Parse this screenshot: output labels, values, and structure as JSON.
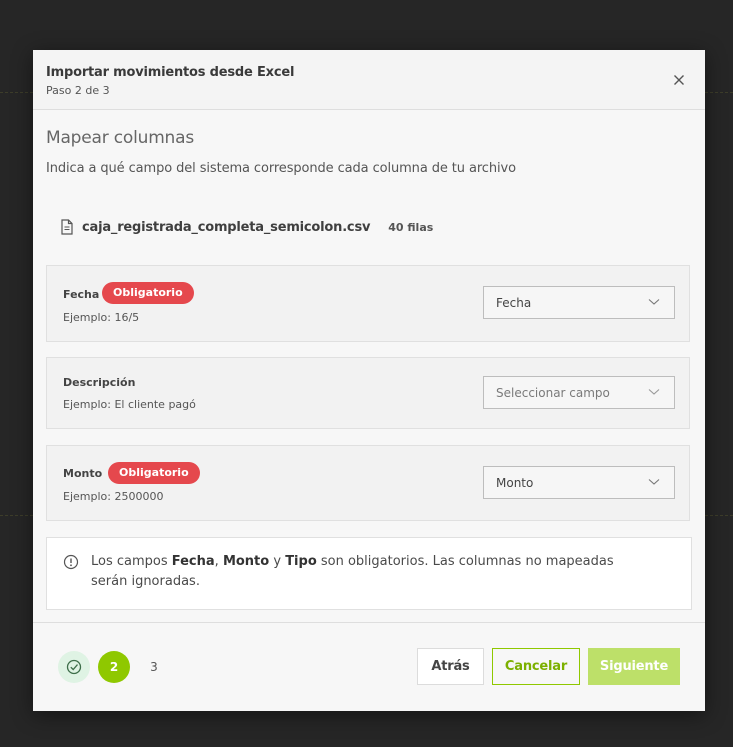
{
  "modal": {
    "title": "Importar movimientos desde Excel",
    "subtitle": "Paso 2 de 3"
  },
  "section": {
    "title": "Mapear columnas",
    "description": "Indica a qué campo del sistema corresponde cada columna de tu archivo"
  },
  "file": {
    "icon": "file-icon",
    "name": "caja_registrada_completa_semicolon.csv",
    "rows": "40 filas"
  },
  "mappings": [
    {
      "field": "Fecha",
      "required_label": "Obligatorio",
      "example": "Ejemplo: 16/5",
      "selected": "Fecha"
    },
    {
      "field": "Descripción",
      "example": "Ejemplo: El cliente pagó",
      "placeholder": "Seleccionar campo"
    },
    {
      "field": "Monto",
      "required_label": "Obligatorio",
      "example": "Ejemplo: 2500000",
      "selected": "Monto"
    }
  ],
  "info": {
    "prefix": "Los campos ",
    "f1": "Fecha",
    "sep1": ", ",
    "f2": "Monto",
    "sep2": " y ",
    "f3": "Tipo",
    "suffix": " son obligatorios. Las columnas no mapeadas serán ignoradas."
  },
  "stepper": {
    "current": "2",
    "next": "3"
  },
  "buttons": {
    "back": "Atrás",
    "cancel": "Cancelar",
    "next": "Siguiente"
  },
  "colors": {
    "accent": "#8fc800",
    "required_badge": "#e5484d",
    "done_step_bg": "#dff3e4"
  }
}
